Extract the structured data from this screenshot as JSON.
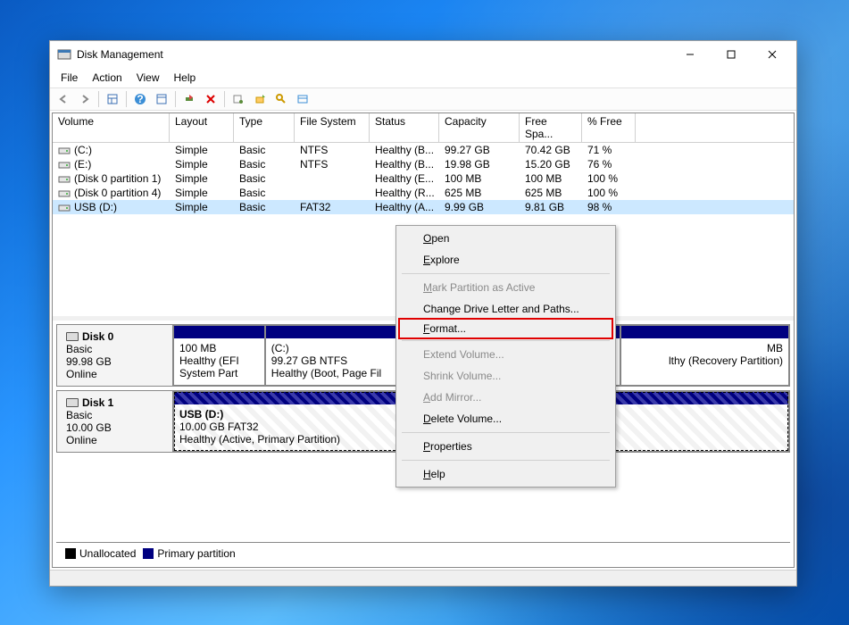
{
  "window": {
    "title": "Disk Management"
  },
  "menubar": {
    "file": "File",
    "action": "Action",
    "view": "View",
    "help": "Help"
  },
  "columns": {
    "volume": "Volume",
    "layout": "Layout",
    "type": "Type",
    "fs": "File System",
    "status": "Status",
    "capacity": "Capacity",
    "freespace": "Free Spa...",
    "pctfree": "% Free"
  },
  "col_widths": {
    "volume": 131,
    "layout": 72,
    "type": 68,
    "fs": 84,
    "status": 78,
    "capacity": 90,
    "freespace": 70,
    "pctfree": 60
  },
  "volumes": [
    {
      "name": "(C:)",
      "layout": "Simple",
      "type": "Basic",
      "fs": "NTFS",
      "status": "Healthy (B...",
      "capacity": "99.27 GB",
      "free": "70.42 GB",
      "pct": "71 %"
    },
    {
      "name": "(E:)",
      "layout": "Simple",
      "type": "Basic",
      "fs": "NTFS",
      "status": "Healthy (B...",
      "capacity": "19.98 GB",
      "free": "15.20 GB",
      "pct": "76 %"
    },
    {
      "name": "(Disk 0 partition 1)",
      "layout": "Simple",
      "type": "Basic",
      "fs": "",
      "status": "Healthy (E...",
      "capacity": "100 MB",
      "free": "100 MB",
      "pct": "100 %"
    },
    {
      "name": "(Disk 0 partition 4)",
      "layout": "Simple",
      "type": "Basic",
      "fs": "",
      "status": "Healthy (R...",
      "capacity": "625 MB",
      "free": "625 MB",
      "pct": "100 %"
    },
    {
      "name": "USB (D:)",
      "layout": "Simple",
      "type": "Basic",
      "fs": "FAT32",
      "status": "Healthy (A...",
      "capacity": "9.99 GB",
      "free": "9.81 GB",
      "pct": "98 %",
      "selected": true
    }
  ],
  "disks": [
    {
      "name": "Disk 0",
      "type": "Basic",
      "size": "99.98 GB",
      "status": "Online",
      "parts": [
        {
          "label": "",
          "size": "100 MB",
          "desc": "Healthy (EFI System Part",
          "flex": 14
        },
        {
          "label": "(C:)",
          "size": "99.27 GB NTFS",
          "desc": "Healthy (Boot, Page Fil",
          "flex": 55
        },
        {
          "label": "MB",
          "size": "",
          "desc": "lthy (Recovery Partition)",
          "flex": 26,
          "cut_left": true
        }
      ]
    },
    {
      "name": "Disk 1",
      "type": "Basic",
      "size": "10.00 GB",
      "status": "Online",
      "parts": [
        {
          "label": "USB  (D:)",
          "size": "10.00 GB FAT32",
          "desc": "Healthy (Active, Primary Partition)",
          "flex": 100,
          "selected": true,
          "hatched": true,
          "bold": true
        }
      ]
    }
  ],
  "legend": {
    "unallocated": "Unallocated",
    "primary": "Primary partition"
  },
  "context_menu": {
    "open": "Open",
    "explore": "Explore",
    "mark_active": "Mark Partition as Active",
    "change_letter": "Change Drive Letter and Paths...",
    "format": "Format...",
    "extend": "Extend Volume...",
    "shrink": "Shrink Volume...",
    "add_mirror": "Add Mirror...",
    "delete": "Delete Volume...",
    "properties": "Properties",
    "help": "Help"
  }
}
